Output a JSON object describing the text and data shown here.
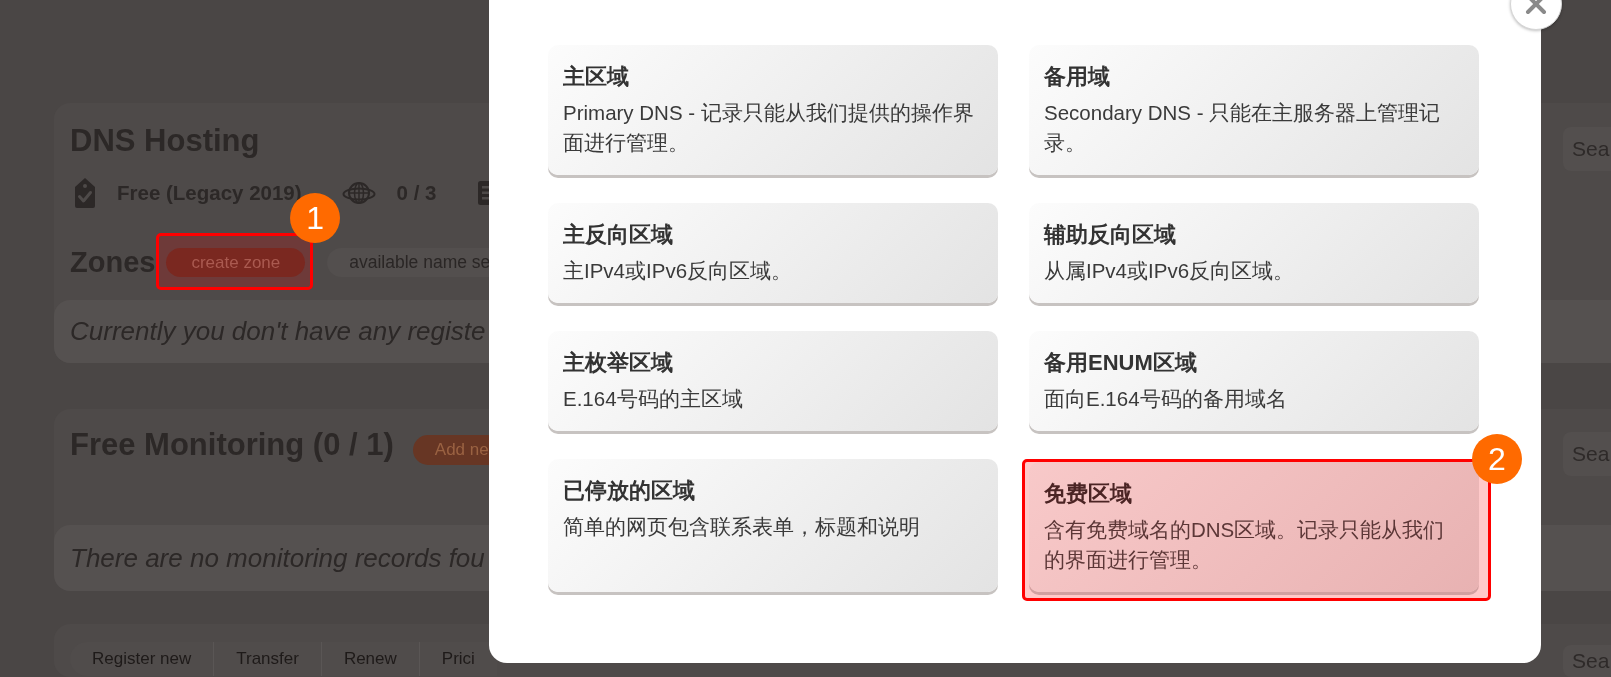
{
  "page": {
    "hosting": {
      "title": "DNS Hosting",
      "plan": "Free (Legacy 2019)",
      "zone_count": "0 / 3",
      "search": {
        "placeholder": "Sea"
      },
      "zones": {
        "heading": "Zones",
        "buttons": [
          {
            "label": "create zone",
            "kind": "primary",
            "highlighted": true
          },
          {
            "label": "available name se",
            "kind": "secondary",
            "highlighted": false
          }
        ]
      },
      "empty_message": "Currently you don't have any registe"
    },
    "monitoring": {
      "title": "Free Monitoring (0 / 1)",
      "button": {
        "label": "Add ne",
        "kind": "accent"
      },
      "search": {
        "placeholder": "Sea"
      },
      "empty_message": "There are no monitoring records fou"
    },
    "domains": {
      "actions": [
        "Register new",
        "Transfer",
        "Renew",
        "Prici"
      ],
      "search": {
        "placeholder": "Sea"
      }
    }
  },
  "dialog": {
    "options": [
      {
        "title": "主区域",
        "description": "Primary DNS - 记录只能从我们提供的操作界面进行管理。",
        "highlighted": false
      },
      {
        "title": "备用域",
        "description": "Secondary DNS - 只能在主服务器上管理记录。",
        "highlighted": false
      },
      {
        "title": "主反向区域",
        "description": "主IPv4或IPv6反向区域。",
        "highlighted": false
      },
      {
        "title": "辅助反向区域",
        "description": "从属IPv4或IPv6反向区域。",
        "highlighted": false
      },
      {
        "title": "主枚举区域",
        "description": "E.164号码的主区域",
        "highlighted": false
      },
      {
        "title": "备用ENUM区域",
        "description": "面向E.164号码的备用域名",
        "highlighted": false
      },
      {
        "title": "已停放的区域",
        "description": "简单的网页包含联系表单，标题和说明",
        "highlighted": false
      },
      {
        "title": "免费区域",
        "description": "含有免费域名的DNS区域。记录只能从我们的界面进行管理。",
        "highlighted": true
      }
    ]
  },
  "annotations": {
    "step_badges": [
      "1",
      "2"
    ]
  }
}
